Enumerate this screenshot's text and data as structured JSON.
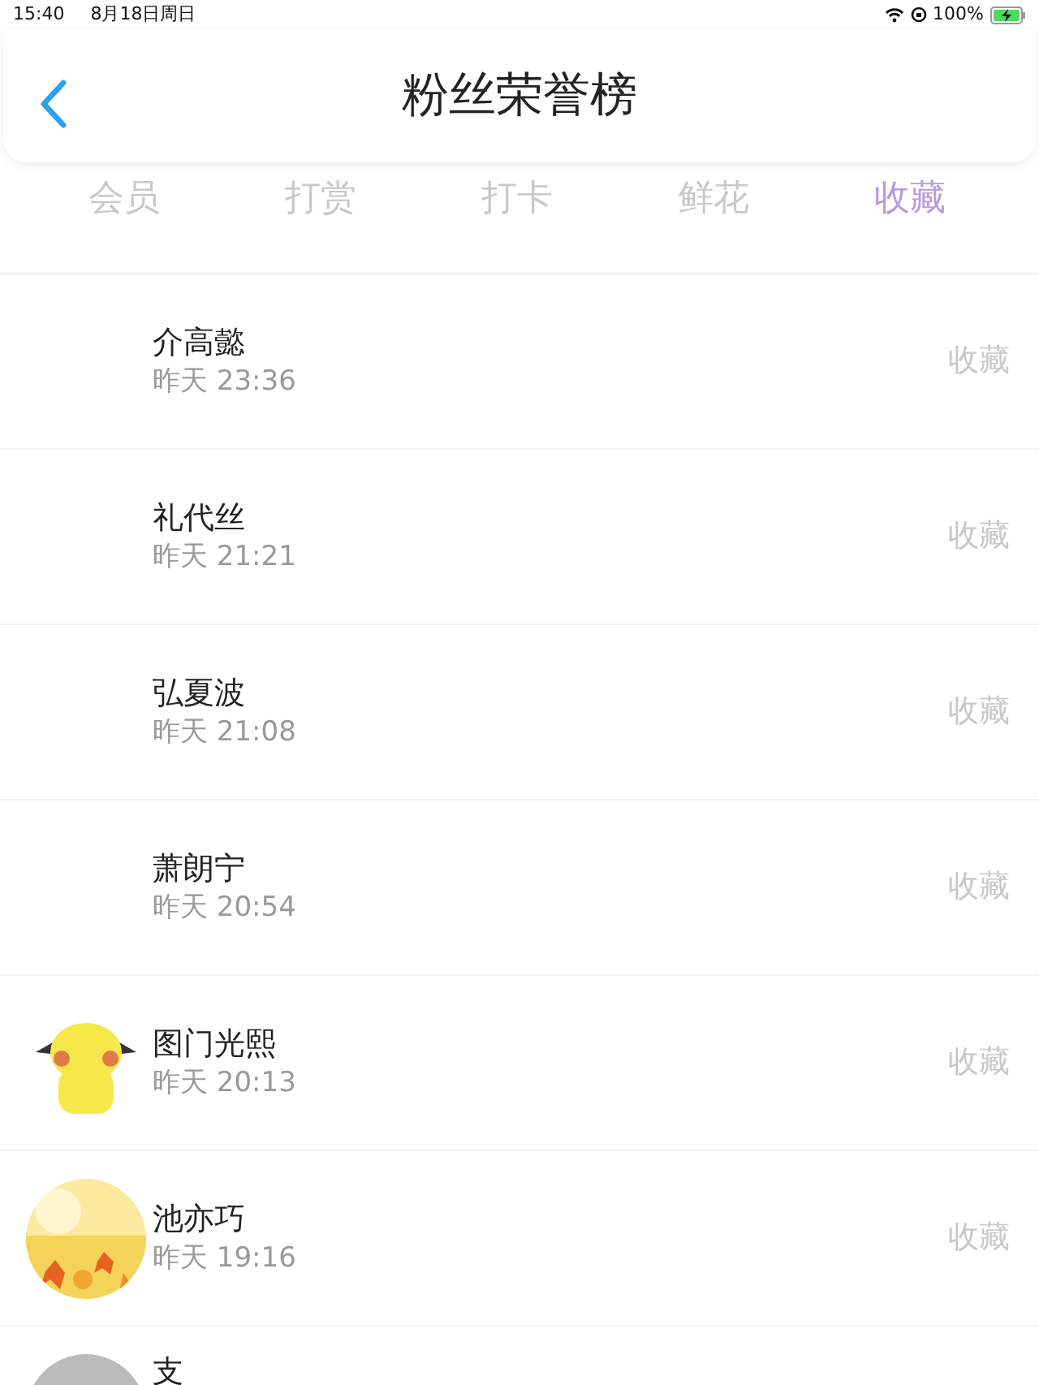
{
  "status_bar": {
    "time": "15:40",
    "date": "8月18日周日",
    "battery": "100%"
  },
  "header": {
    "title": "粉丝荣誉榜"
  },
  "tabs": [
    {
      "label": "会员",
      "selected": false
    },
    {
      "label": "打赏",
      "selected": false
    },
    {
      "label": "打卡",
      "selected": false
    },
    {
      "label": "鲜花",
      "selected": false
    },
    {
      "label": "收藏",
      "selected": true
    }
  ],
  "rows": [
    {
      "name": "介高懿",
      "time": "昨天 23:36",
      "action": "收藏"
    },
    {
      "name": "礼代丝",
      "time": "昨天 21:21",
      "action": "收藏"
    },
    {
      "name": "弘夏波",
      "time": "昨天 21:08",
      "action": "收藏"
    },
    {
      "name": "萧朗宁",
      "time": "昨天 20:54",
      "action": "收藏"
    },
    {
      "name": "图门光熙",
      "time": "昨天 20:13",
      "action": "收藏"
    },
    {
      "name": "池亦巧",
      "time": "昨天 19:16",
      "action": "收藏"
    },
    {
      "name": "支"
    }
  ]
}
